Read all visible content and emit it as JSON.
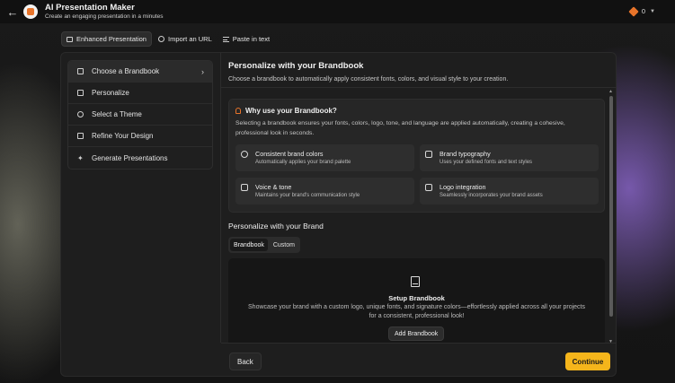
{
  "app": {
    "title": "AI Presentation Maker",
    "subtitle": "Create an engaging presentation in a minutes",
    "credits": "0",
    "accent": "#e8742a"
  },
  "mode_tabs": [
    {
      "label": "Enhanced Presentation",
      "icon": "monitor-icon",
      "active": true
    },
    {
      "label": "Import an URL",
      "icon": "globe-icon",
      "active": false
    },
    {
      "label": "Paste in text",
      "icon": "text-lines-icon",
      "active": false
    }
  ],
  "steps": [
    {
      "label": "Choose a Brandbook",
      "icon": "brandbook-icon",
      "active": true
    },
    {
      "label": "Personalize",
      "icon": "personalize-icon",
      "active": false
    },
    {
      "label": "Select a Theme",
      "icon": "palette-icon",
      "active": false
    },
    {
      "label": "Refine Your Design",
      "icon": "refine-icon",
      "active": false
    },
    {
      "label": "Generate Presentations",
      "icon": "sparkle-icon",
      "active": false
    }
  ],
  "content": {
    "title": "Personalize with your Brandbook",
    "description": "Choose a brandbook to automatically apply consistent fonts, colors, and visual style to your creation."
  },
  "why": {
    "title": "Why use your Brandbook?",
    "description": "Selecting a brandbook ensures your fonts, colors, logo, tone, and language are applied automatically, creating a cohesive, professional look in seconds.",
    "features": [
      {
        "title": "Consistent brand colors",
        "desc": "Automatically applies your brand palette",
        "icon": "palette-icon"
      },
      {
        "title": "Brand typography",
        "desc": "Uses your defined fonts and text styles",
        "icon": "typography-icon"
      },
      {
        "title": "Voice & tone",
        "desc": "Maintains your brand's communication style",
        "icon": "chat-icon"
      },
      {
        "title": "Logo integration",
        "desc": "Seamlessly incorporates your brand assets",
        "icon": "image-icon"
      }
    ]
  },
  "brand": {
    "heading": "Personalize with your Brand",
    "tabs": [
      "Brandbook",
      "Custom"
    ]
  },
  "setup": {
    "title": "Setup Brandbook",
    "description": "Showcase your brand with a custom logo, unique fonts, and signature colors—effortlessly applied across all your projects for a consistent, professional look!",
    "button": "Add Brandbook"
  },
  "footer": {
    "back": "Back",
    "continue": "Continue",
    "continue_color": "#f5b51b"
  }
}
